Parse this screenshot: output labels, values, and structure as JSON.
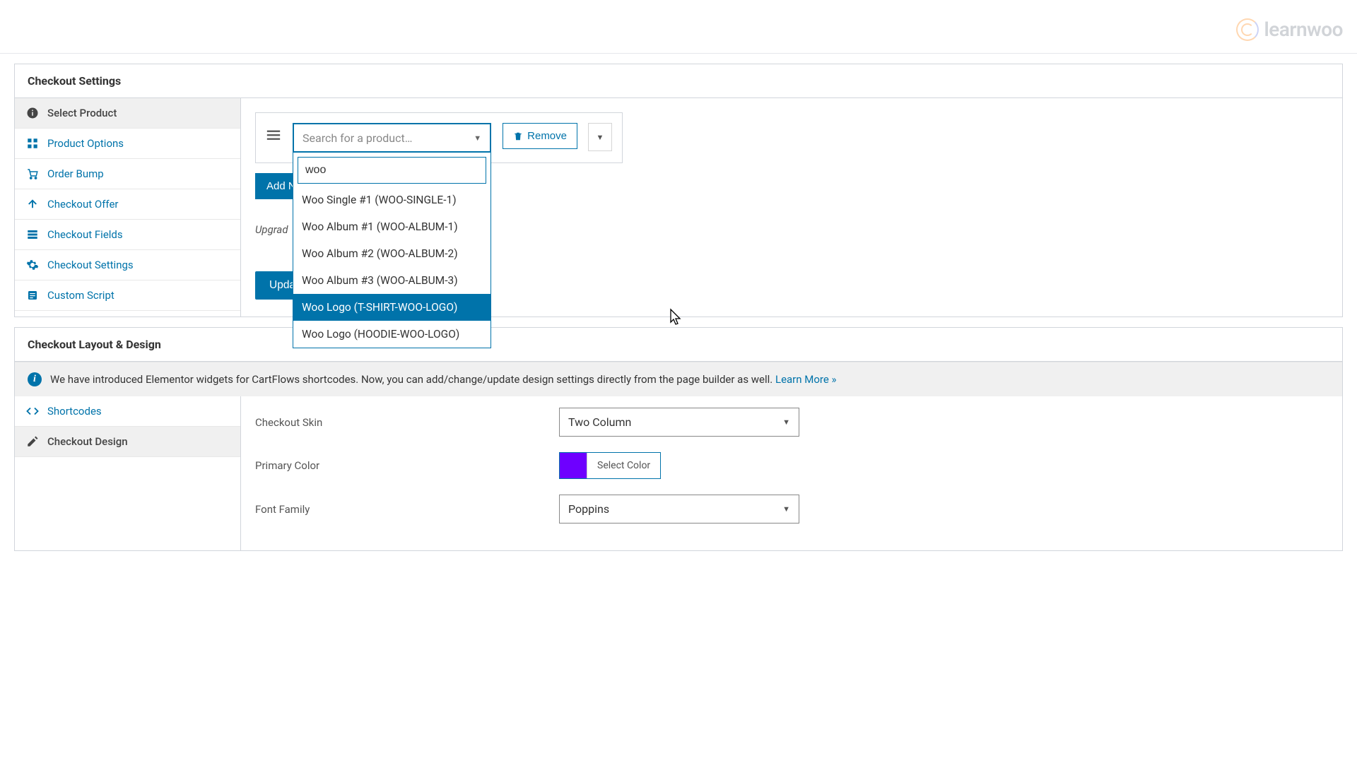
{
  "watermark": "learnwoo",
  "panel1": {
    "title": "Checkout Settings",
    "sidebar": [
      {
        "label": "Select Product",
        "icon": "info",
        "active": true
      },
      {
        "label": "Product Options",
        "icon": "grid",
        "active": false
      },
      {
        "label": "Order Bump",
        "icon": "cart",
        "active": false
      },
      {
        "label": "Checkout Offer",
        "icon": "upload",
        "active": false
      },
      {
        "label": "Checkout Fields",
        "icon": "fields",
        "active": false
      },
      {
        "label": "Checkout Settings",
        "icon": "gear",
        "active": false
      },
      {
        "label": "Custom Script",
        "icon": "script",
        "active": false
      }
    ]
  },
  "product_search": {
    "placeholder": "Search for a product…",
    "query": "woo",
    "options": [
      "Woo Single #1 (WOO-SINGLE-1)",
      "Woo Album #1 (WOO-ALBUM-1)",
      "Woo Album #2 (WOO-ALBUM-2)",
      "Woo Album #3 (WOO-ALBUM-3)",
      "Woo Logo (T-SHIRT-WOO-LOGO)",
      "Woo Logo (HOODIE-WOO-LOGO)"
    ],
    "highlighted_index": 4
  },
  "buttons": {
    "remove": "Remove",
    "add_new": "Add New Product",
    "update": "Update"
  },
  "upgrade_text": "Upgrad",
  "panel2": {
    "title": "Checkout Layout & Design",
    "info_text": "We have introduced Elementor widgets for CartFlows shortcodes. Now, you can add/change/update design settings directly from the page builder as well. ",
    "info_link": "Learn More »",
    "sidebar": [
      {
        "label": "Shortcodes",
        "icon": "code",
        "active": false
      },
      {
        "label": "Checkout Design",
        "icon": "pencil",
        "active": true
      }
    ]
  },
  "design": {
    "skin_label": "Checkout Skin",
    "skin_value": "Two Column",
    "color_label": "Primary Color",
    "color_value": "#6e00ff",
    "color_button": "Select Color",
    "font_label": "Font Family",
    "font_value": "Poppins"
  }
}
